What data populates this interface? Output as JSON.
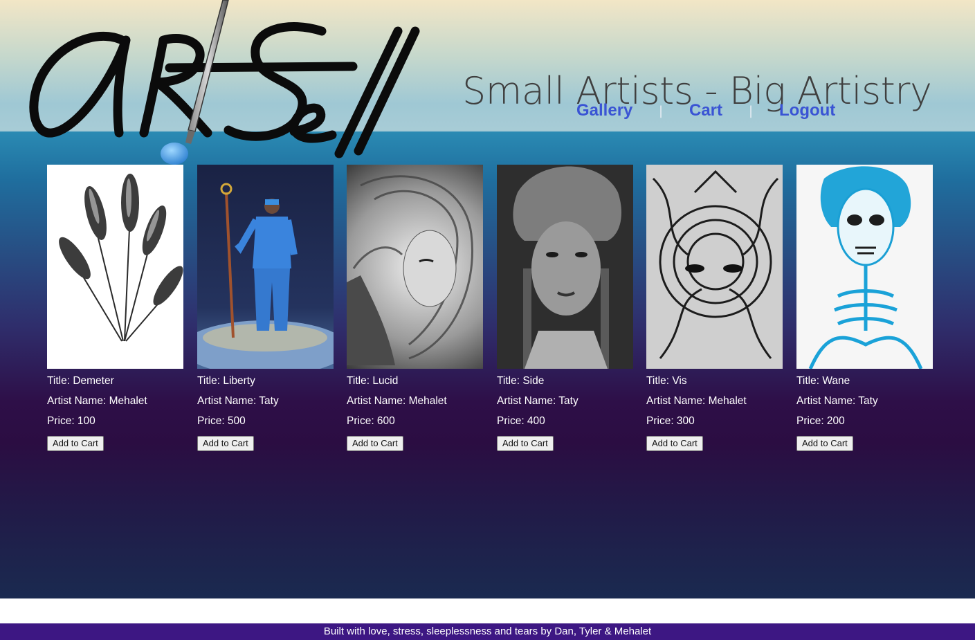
{
  "brand": {
    "logo_text": "ArtSell",
    "tagline": "Small Artists - Big Artistry"
  },
  "nav": {
    "items": [
      {
        "label": "Gallery"
      },
      {
        "label": "Cart"
      },
      {
        "label": "Logout"
      }
    ],
    "separator": "|"
  },
  "cards": [
    {
      "title": "Title: Demeter",
      "artist": "Artist Name: Mehalet",
      "price": "Price: 100",
      "button": "Add to Cart"
    },
    {
      "title": "Title: Liberty",
      "artist": "Artist Name: Taty",
      "price": "Price: 500",
      "button": "Add to Cart"
    },
    {
      "title": "Title: Lucid",
      "artist": "Artist Name: Mehalet",
      "price": "Price: 600",
      "button": "Add to Cart"
    },
    {
      "title": "Title: Side",
      "artist": "Artist Name: Taty",
      "price": "Price: 400",
      "button": "Add to Cart"
    },
    {
      "title": "Title: Vis",
      "artist": "Artist Name: Mehalet",
      "price": "Price: 300",
      "button": "Add to Cart"
    },
    {
      "title": "Title: Wane",
      "artist": "Artist Name: Taty",
      "price": "Price: 200",
      "button": "Add to Cart"
    }
  ],
  "footer": {
    "text": "Built with love, stress, sleeplessness and tears by Dan, Tyler & Mehalet"
  }
}
